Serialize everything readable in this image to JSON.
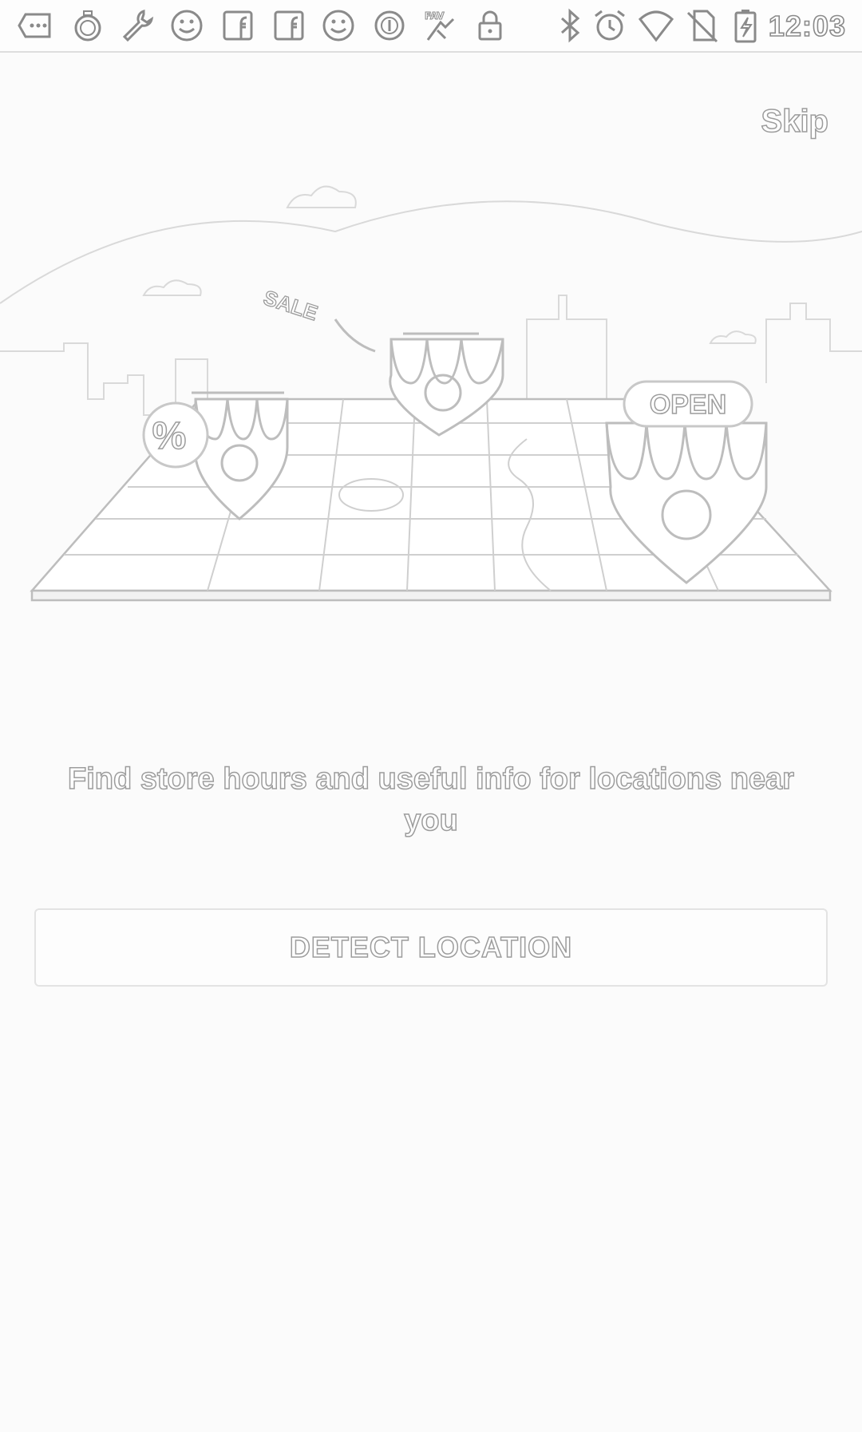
{
  "status_bar": {
    "time": "12:03",
    "left_icons": [
      "more-icon",
      "stopwatch-icon",
      "wrench-icon",
      "smiley-icon",
      "facebook-icon",
      "facebook-icon",
      "smiley-icon",
      "circle-icon",
      "fav-icon",
      "lock-icon"
    ],
    "right_icons": [
      "bluetooth-icon",
      "alarm-icon",
      "wifi-icon",
      "no-sim-icon",
      "battery-charging-icon"
    ]
  },
  "header": {
    "skip_label": "Skip"
  },
  "illustration": {
    "sale_label": "SALE",
    "open_label": "OPEN",
    "percent_label": "%"
  },
  "main": {
    "caption": "Find store hours and useful info for locations near you",
    "detect_button_label": "DETECT LOCATION"
  },
  "colors": {
    "background": "#fbfbfb",
    "outline": "#9c9c9c"
  }
}
